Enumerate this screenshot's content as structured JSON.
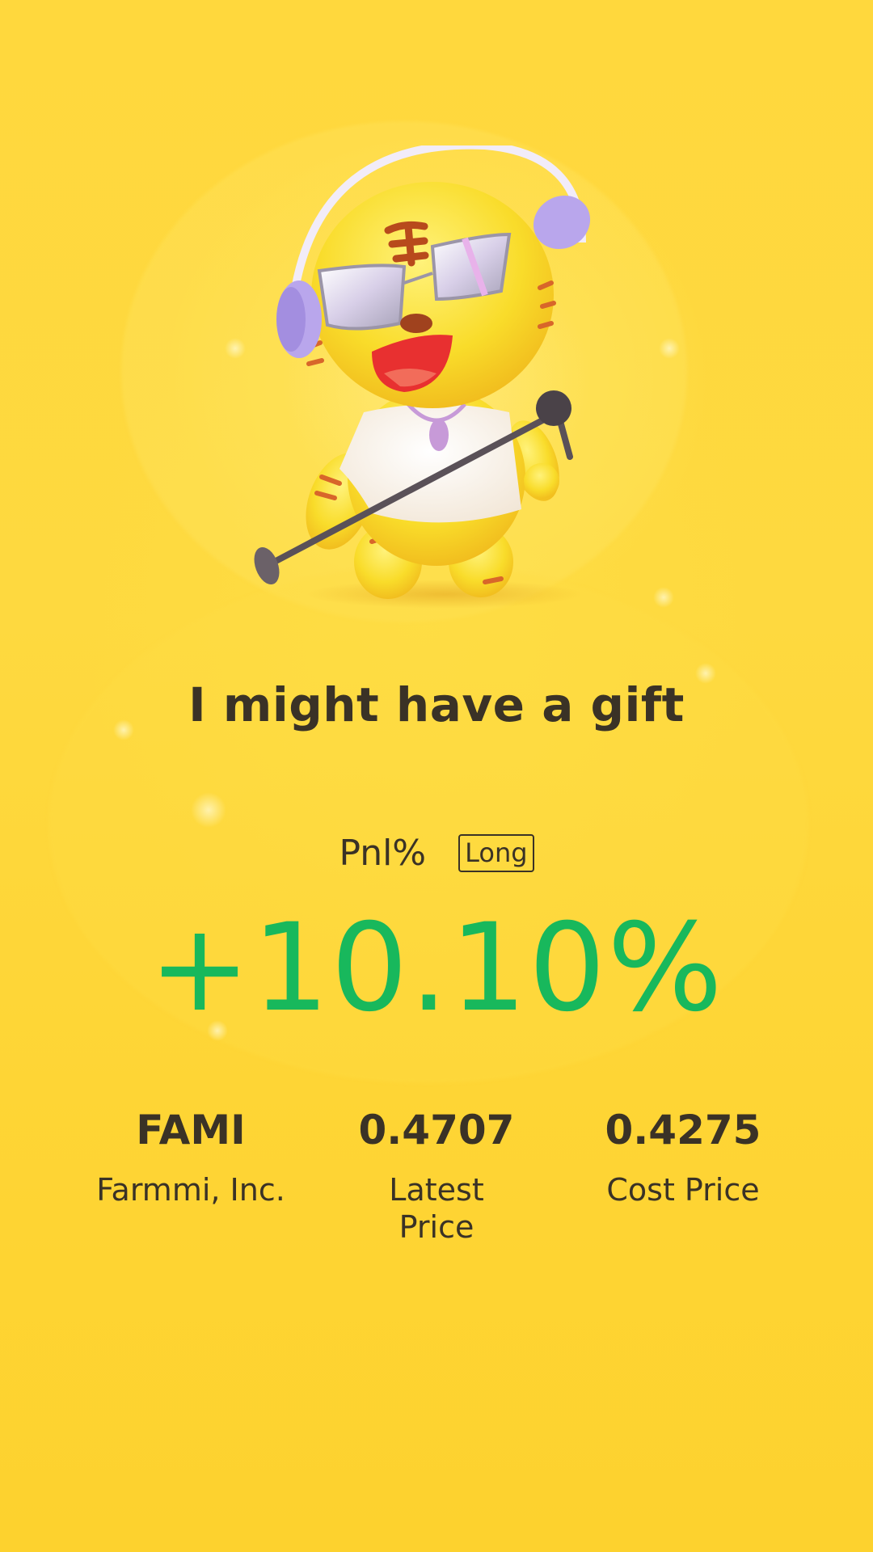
{
  "headline": "I might have a gift",
  "pnl": {
    "label": "Pnl%",
    "position_badge": "Long",
    "value": "+10.10%"
  },
  "stats": {
    "symbol": "FAMI",
    "company": "Farmmi, Inc.",
    "latest_price_value": "0.4707",
    "latest_price_label": "Latest Price",
    "cost_price_value": "0.4275",
    "cost_price_label": "Cost Price"
  },
  "colors": {
    "background": "#fdd535",
    "text": "#3a3226",
    "gain": "#18b85c"
  },
  "icons": {
    "mascot": "tiger-mascot-with-headphones-and-microphone"
  }
}
